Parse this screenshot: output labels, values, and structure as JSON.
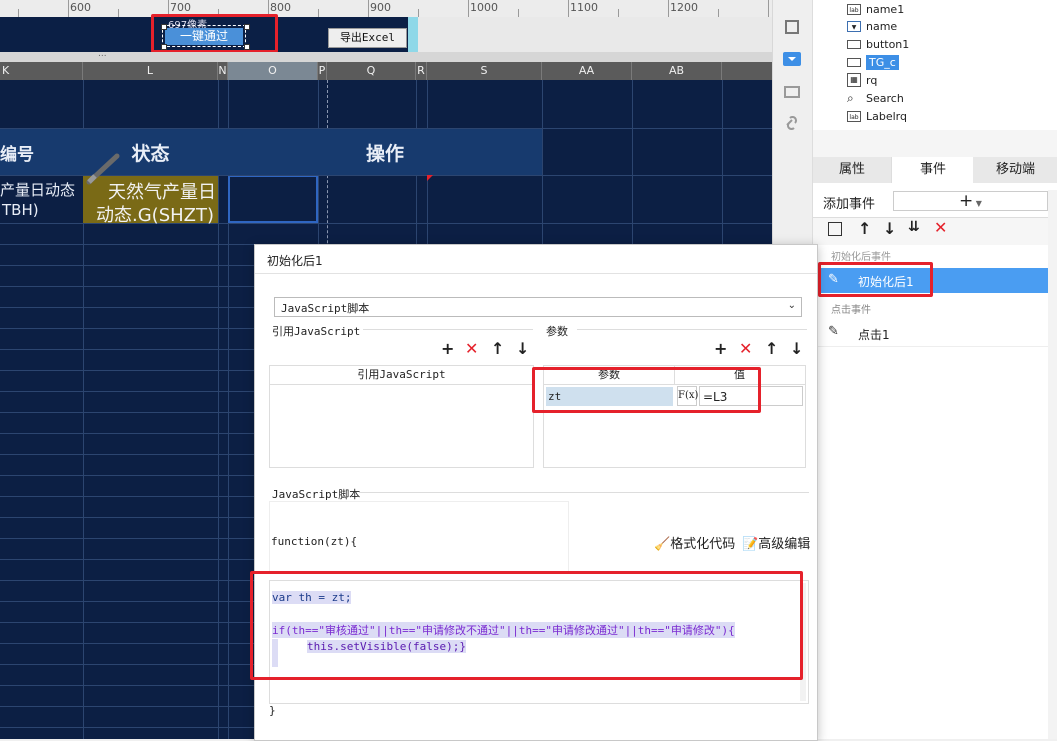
{
  "ruler": {
    "ticks": [
      "600",
      "700",
      "800",
      "900",
      "1000",
      "1100",
      "1200"
    ]
  },
  "toolbar": {
    "tooltip_label": "697像素",
    "one_click_pass": "一键通过",
    "export_excel": "导出Excel",
    "more_dots": "..."
  },
  "sheet": {
    "columns": [
      "K",
      "L",
      "N",
      "O",
      "P",
      "Q",
      "R",
      "S",
      "AA",
      "AB"
    ],
    "headers": {
      "id_col": "编号",
      "status": "状态",
      "operation": "操作"
    },
    "row1": {
      "left_text_1": "产量日动态",
      "left_text_2": "TBH)",
      "status_text_1": "天然气产量日",
      "status_text_2": "动态.G(SHZT)"
    }
  },
  "right_panel": {
    "tree": [
      {
        "icon": "label-icon",
        "label": "name1"
      },
      {
        "icon": "combo-icon",
        "label": "name"
      },
      {
        "icon": "button-icon",
        "label": "button1"
      },
      {
        "icon": "textbox-icon",
        "label": "TG_c"
      },
      {
        "icon": "calendar-icon",
        "label": "rq"
      },
      {
        "icon": "search-icon",
        "label": "Search"
      },
      {
        "icon": "label-icon",
        "label": "Labelrq"
      }
    ],
    "tabs": [
      "属性",
      "事件",
      "移动端"
    ],
    "add_event_label": "添加事件",
    "add_event_value": "+",
    "section_after_init": "初始化后事件",
    "event_after_init": "初始化后1",
    "section_click": "点击事件",
    "event_click": "点击1"
  },
  "dialog": {
    "title": "初始化后1",
    "script_type": "JavaScript脚本",
    "ref_js_label": "引用JavaScript",
    "params_label": "参数",
    "ref_js_column": "引用JavaScript",
    "param_col_name": "参数",
    "param_col_value": "值",
    "param_name": "zt",
    "param_fx": "F(x)",
    "param_value": "=L3",
    "js_script_label": "JavaScript脚本",
    "function_signature": "function(zt){",
    "format_code": "格式化代码",
    "advanced_edit": "高级编辑",
    "code_line_1": "var th = zt;",
    "code_line_2": "if(th==\"审核通过\"||th==\"申请修改不通过\"||th==\"申请修改通过\"||th==\"申请修改\"){",
    "code_line_3": "this.setVisible(false);}",
    "closing_brace": "}"
  },
  "colors": {
    "accent": "#4a90d9",
    "navy": "#0c1f44",
    "highlight": "#e5212b",
    "selected": "#4a9df2"
  }
}
